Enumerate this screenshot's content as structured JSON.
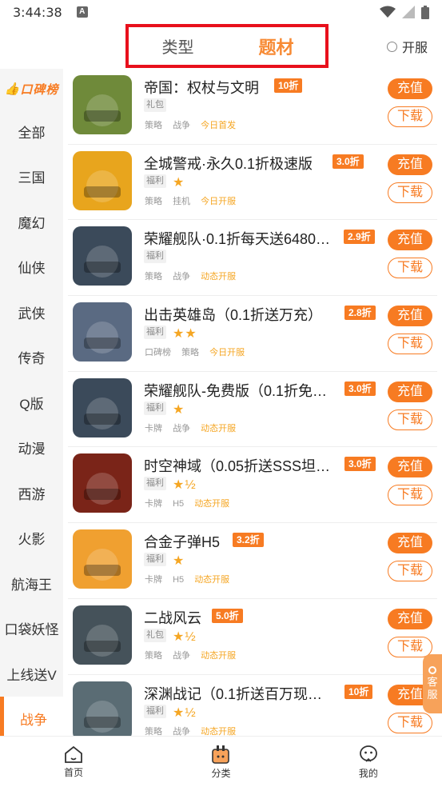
{
  "status_bar": {
    "time": "3:44:38",
    "badge": "A"
  },
  "header": {
    "tabs": [
      {
        "label": "类型"
      },
      {
        "label": "题材"
      }
    ],
    "kaifu_label": "开服"
  },
  "sidebar": {
    "rank_label": "口碑榜",
    "categories": [
      "全部",
      "三国",
      "魔幻",
      "仙侠",
      "武侠",
      "传奇",
      "Q版",
      "动漫",
      "西游",
      "火影",
      "航海王",
      "口袋妖怪",
      "上线送V",
      "战争"
    ]
  },
  "games": [
    {
      "name": "帝国：权杖与文明",
      "discount": "10折",
      "tag": "礼包",
      "stars": "",
      "meta": [
        "策略",
        "战争"
      ],
      "status": "今日首发",
      "icon": "soldier-icon",
      "icon_color": "#6f8a3a"
    },
    {
      "name": "全城警戒·永久0.1折极速版",
      "discount": "3.0折",
      "tag": "福利",
      "stars": "★",
      "meta": [
        "策略",
        "挂机"
      ],
      "status": "今日开服",
      "icon": "tank-badge-icon",
      "icon_color": "#e8a51d"
    },
    {
      "name": "荣耀舰队·0.1折每天送6480…",
      "discount": "2.9折",
      "tag": "福利",
      "stars": "",
      "meta": [
        "策略",
        "战争"
      ],
      "status": "动态开服",
      "icon": "warship-icon",
      "icon_color": "#3b4a5a"
    },
    {
      "name": "出击英雄岛（0.1折送万充）",
      "discount": "2.8折",
      "tag": "福利",
      "stars": "★★",
      "meta": [
        "口碑榜",
        "策略"
      ],
      "status": "今日开服",
      "icon": "heroine-icon",
      "icon_color": "#5a6a82"
    },
    {
      "name": "荣耀舰队-免费版（0.1折免…",
      "discount": "3.0折",
      "tag": "福利",
      "stars": "★",
      "meta": [
        "卡牌",
        "战争"
      ],
      "status": "动态开服",
      "icon": "warship-icon",
      "icon_color": "#3b4a5a"
    },
    {
      "name": "时空神域（0.05折送SSS坦…",
      "discount": "3.0折",
      "tag": "福利",
      "stars": "★½",
      "meta": [
        "卡牌",
        "H5"
      ],
      "status": "动态开服",
      "icon": "tank-icon",
      "icon_color": "#7a2418"
    },
    {
      "name": "合金子弹H5",
      "discount": "3.2折",
      "tag": "福利",
      "stars": "★",
      "meta": [
        "卡牌",
        "H5"
      ],
      "status": "动态开服",
      "icon": "explosion-icon",
      "icon_color": "#f0a030"
    },
    {
      "name": "二战风云",
      "discount": "5.0折",
      "tag": "礼包",
      "stars": "★½",
      "meta": [
        "策略",
        "战争"
      ],
      "status": "动态开服",
      "icon": "helmet-soldier-icon",
      "icon_color": "#45525a"
    },
    {
      "name": "深渊战记（0.1折送百万现…",
      "discount": "10折",
      "tag": "福利",
      "stars": "★½",
      "meta": [
        "策略",
        "战争"
      ],
      "status": "动态开服",
      "icon": "mech-icon",
      "icon_color": "#5a6c74"
    }
  ],
  "buttons": {
    "recharge": "充值",
    "download": "下载"
  },
  "service": {
    "line1": "客",
    "line2": "服"
  },
  "bottom_nav": [
    {
      "label": "首页"
    },
    {
      "label": "分类"
    },
    {
      "label": "我的"
    }
  ]
}
